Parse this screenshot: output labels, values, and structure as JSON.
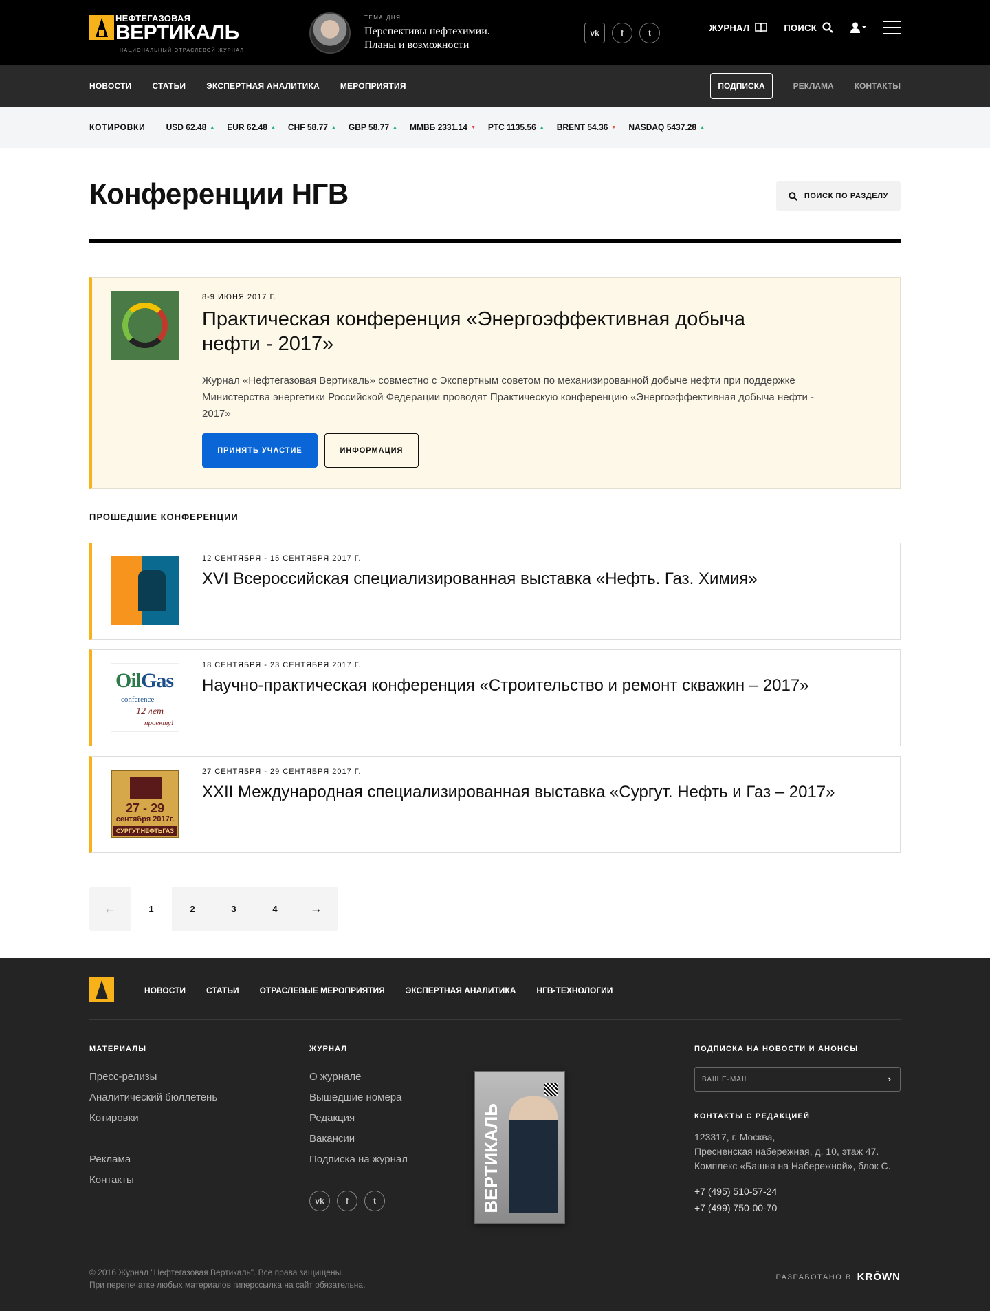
{
  "header": {
    "logo_top": "НЕФТЕГАЗОВАЯ",
    "logo_main": "ВЕРТИКАЛЬ",
    "logo_sub": "НАЦИОНАЛЬНЫЙ ОТРАСЛЕВОЙ ЖУРНАЛ",
    "topic_label": "ТЕМА ДНЯ",
    "topic_line1": "Перспективы нефтехимии.",
    "topic_line2": "Планы и возможности",
    "social": [
      "vk-icon",
      "facebook-icon",
      "twitter-icon"
    ],
    "journal": "ЖУРНАЛ",
    "search": "ПОИСК"
  },
  "nav": {
    "items": [
      "НОВОСТИ",
      "СТАТЬИ",
      "ЭКСПЕРТНАЯ АНАЛИТИКА",
      "МЕРОПРИЯТИЯ"
    ],
    "subscribe": "ПОДПИСКА",
    "ads": "РЕКЛАМА",
    "contacts": "КОНТАКТЫ"
  },
  "quotes": {
    "label": "КОТИРОВКИ",
    "items": [
      {
        "text": "USD 62.48",
        "dir": "up"
      },
      {
        "text": "EUR 62.48",
        "dir": "up"
      },
      {
        "text": "CHF 58.77",
        "dir": "up"
      },
      {
        "text": "GBP 58.77",
        "dir": "up"
      },
      {
        "text": "ММВБ 2331.14",
        "dir": "down"
      },
      {
        "text": "РТС 1135.56",
        "dir": "up"
      },
      {
        "text": "BRENT 54.36",
        "dir": "down"
      },
      {
        "text": "NASDAQ 5437.28",
        "dir": "up"
      }
    ]
  },
  "page": {
    "title": "Конференции НГВ",
    "search_section": "ПОИСК ПО РАЗДЕЛУ"
  },
  "featured": {
    "date": "8-9 ИЮНЯ 2017 Г.",
    "title": "Практическая конференция «Энергоэффективная добыча нефти - 2017»",
    "description": "Журнал «Нефтегазовая Вертикаль» совместно с Экспертным советом по механизированной добыче нефти при поддержке Министерства энергетики Российской Федерации проводят Практическую конференцию «Энергоэффективная добыча нефти - 2017»",
    "btn_participate": "ПРИНЯТЬ УЧАСТИЕ",
    "btn_info": "ИНФОРМАЦИЯ"
  },
  "past": {
    "heading": "ПРОШЕДШИЕ КОНФЕРЕНЦИИ",
    "items": [
      {
        "date": "12 СЕНТЯБРЯ - 15 СЕНТЯБРЯ 2017 Г.",
        "title": "XVI Всероссийская специализированная выставка «Нефть. Газ. Химия»"
      },
      {
        "date": "18 СЕНТЯБРЯ - 23 СЕНТЯБРЯ 2017 Г.",
        "title": "Научно-практическая конференция «Строительство и ремонт скважин – 2017»"
      },
      {
        "date": "27 СЕНТЯБРЯ - 29 СЕНТЯБРЯ 2017 Г.",
        "title": "XXII Международная специализированная выставка «Сургут. Нефть и Газ – 2017»"
      }
    ],
    "img2_text": {
      "oil": "Oil",
      "gas": "Gas",
      "conference": "conference",
      "years": "12 лет",
      "project": "проекту!"
    },
    "img3_text": {
      "days": "27 - 29",
      "month": "сентября 2017г.",
      "brand": "СУРГУТ.НЕФТЬГАЗ"
    }
  },
  "pagination": {
    "prev": "←",
    "pages": [
      "1",
      "2",
      "3",
      "4"
    ],
    "next": "→",
    "current": "1"
  },
  "footer": {
    "nav": [
      "НОВОСТИ",
      "СТАТЬИ",
      "ОТРАСЛЕВЫЕ МЕРОПРИЯТИЯ",
      "ЭКСПЕРТНАЯ АНАЛИТИКА",
      "НГВ-ТЕХНОЛОГИИ"
    ],
    "materials_h": "МАТЕРИАЛЫ",
    "materials": [
      "Пресс-релизы",
      "Аналитический бюллетень",
      "Котировки"
    ],
    "materials2": [
      "Реклама",
      "Контакты"
    ],
    "journal_h": "ЖУРНАЛ",
    "journal": [
      "О журнале",
      "Вышедшие номера",
      "Редакция",
      "Вакансии",
      "Подписка на журнал"
    ],
    "magazine_title": "ВЕРТИКАЛЬ",
    "subscribe_h": "ПОДПИСКА НА НОВОСТИ И АНОНСЫ",
    "email_placeholder": "ВАШ E-MAIL",
    "contacts_h": "КОНТАКТЫ С РЕДАКЦИЕЙ",
    "address": [
      "123317, г. Москва,",
      "Пресненская набережная, д. 10, этаж 47.",
      "Комплекс «Башня на Набережной», блок С."
    ],
    "phones": [
      "+7 (495) 510-57-24",
      "+7 (499) 750-00-70"
    ],
    "copyright1": "© 2016 Журнал \"Нефтегазовая Вертикаль\". Все права защищены.",
    "copyright2": "При перепечатке любых материалов гиперссылка на сайт обязательна.",
    "developed": "РАЗРАБОТАНО В",
    "dev_brand": "KRŌWN"
  },
  "colors": {
    "accent": "#f7b219",
    "primary_button": "#0a66d6",
    "up": "#2bb673",
    "down": "#e74c3c"
  }
}
